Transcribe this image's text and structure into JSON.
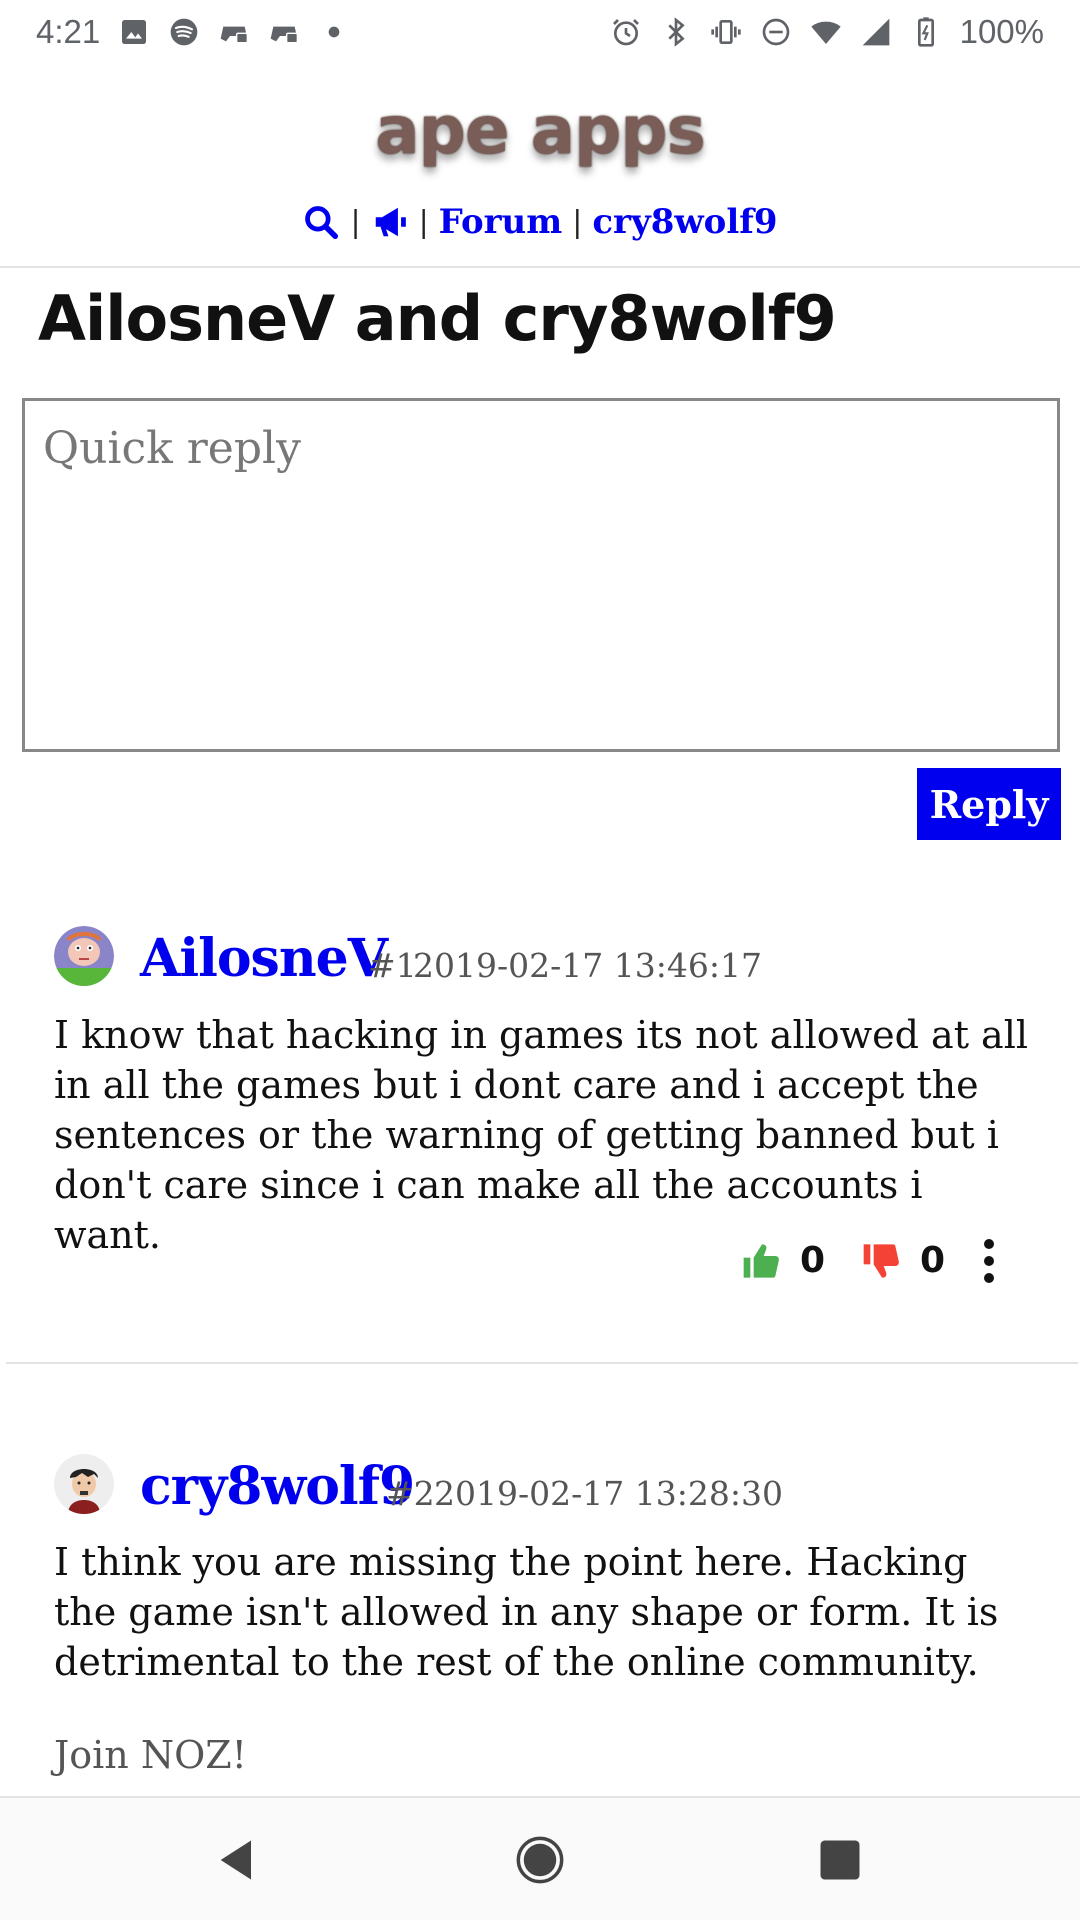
{
  "status_bar": {
    "time": "4:21",
    "battery": "100%",
    "left_icons": [
      "image-icon",
      "spotify-icon",
      "game-controller-icon",
      "game-controller-icon",
      "dot-icon"
    ],
    "right_icons": [
      "alarm-icon",
      "bluetooth-icon",
      "vibrate-icon",
      "do-not-disturb-icon",
      "wifi-icon",
      "cell-signal-icon",
      "battery-charging-icon"
    ]
  },
  "header": {
    "logo_text": "ape apps",
    "nav": {
      "forum_label": "Forum",
      "user_label": "cry8wolf9",
      "separator": "|"
    }
  },
  "thread": {
    "title": "AilosneV and cry8wolf9"
  },
  "quick_reply": {
    "placeholder": "Quick reply",
    "value": "",
    "button_label": "Reply"
  },
  "posts": [
    {
      "author": "AilosneV",
      "number": "#1",
      "timestamp": "2019-02-17 13:46:17",
      "body": "I know that hacking in games its not allowed at all in all the games but i dont care and i accept the sentences or the warning of getting banned but i don't care since i can make all the accounts i want.",
      "likes": "0",
      "dislikes": "0"
    },
    {
      "author": "cry8wolf9",
      "number": "#2",
      "timestamp": "2019-02-17 13:28:30",
      "body": "I think you are missing the point here. Hacking the game isn't allowed in any shape or form. It is detrimental to the rest of the online community.",
      "signature": "Join NOZ!"
    }
  ],
  "colors": {
    "link": "#0000ee",
    "like": "#4caf50",
    "dislike": "#f44336",
    "logo": "#7a5d57"
  },
  "nav_bar": {
    "buttons": [
      "back-icon",
      "home-icon",
      "recents-icon"
    ]
  }
}
